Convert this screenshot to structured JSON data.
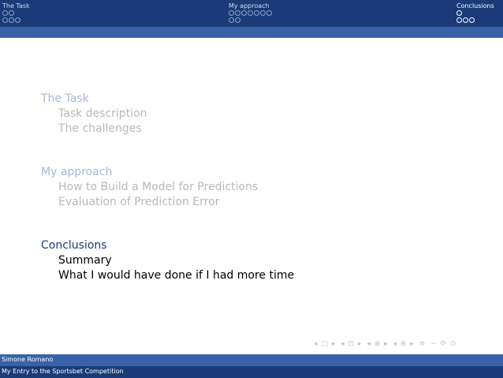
{
  "header": {
    "sections": [
      {
        "label": "The Task"
      },
      {
        "label": "My approach"
      },
      {
        "label": "Conclusions"
      }
    ]
  },
  "toc": {
    "sections": [
      {
        "title": "The Task",
        "subs": [
          "Task description",
          "The challenges"
        ]
      },
      {
        "title": "My approach",
        "subs": [
          "How to Build a Model for Predictions",
          "Evaluation of Prediction Error"
        ]
      },
      {
        "title": "Conclusions",
        "subs": [
          "Summary",
          "What I would have done if I had more time"
        ]
      }
    ]
  },
  "nav": {
    "icons": [
      "nav-first-icon",
      "nav-frame-icon",
      "nav-prev-icon",
      "nav-next-icon",
      "nav-section-icon",
      "nav-subsection-icon",
      "nav-align-icon",
      "nav-search-icon"
    ],
    "glyphs": [
      "◂ □ ▸",
      "◂ ⊡ ▸",
      "◂ ≣ ▸",
      "◂ ≣ ▸",
      "≡",
      "∽ ⟳ ⊙"
    ]
  },
  "footer": {
    "author": "Simone Romano",
    "title": "My Entry to the Sportsbet Competition"
  }
}
